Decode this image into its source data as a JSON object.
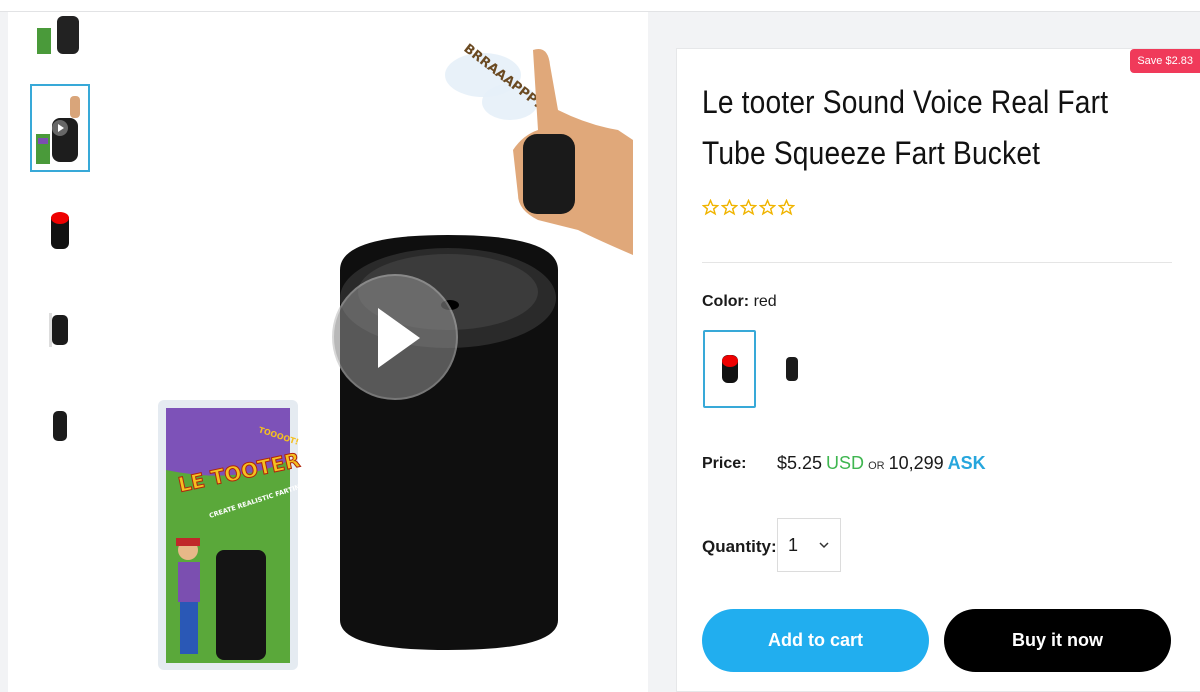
{
  "product": {
    "title": "Le tooter Sound Voice Real Fart Tube Squeeze Fart Bucket",
    "save_badge": "Save $2.83",
    "rating": 0
  },
  "variant": {
    "label": "Color:",
    "selected": "red",
    "options": [
      "red",
      "black"
    ]
  },
  "price": {
    "label": "Price:",
    "amount": "$5.25",
    "currency": "USD",
    "or": "OR",
    "alt_amount": "10,299",
    "alt_currency": "ASK"
  },
  "quantity": {
    "label": "Quantity:",
    "value": "1"
  },
  "actions": {
    "add_to_cart": "Add to cart",
    "buy_now": "Buy it now"
  },
  "media": {
    "video_caption": "BRRAAAPPP!",
    "package_brand": "LE TOOTER",
    "package_tagline": "CREATE REALISTIC FARTING SOUNDS!",
    "package_sound": "TOOOOT!"
  },
  "colors": {
    "accent_blue": "#21aeef",
    "selection_border": "#38a9d8",
    "save_badge": "#f03a5a",
    "usd_green": "#3fb650",
    "star": "#f0b400"
  }
}
